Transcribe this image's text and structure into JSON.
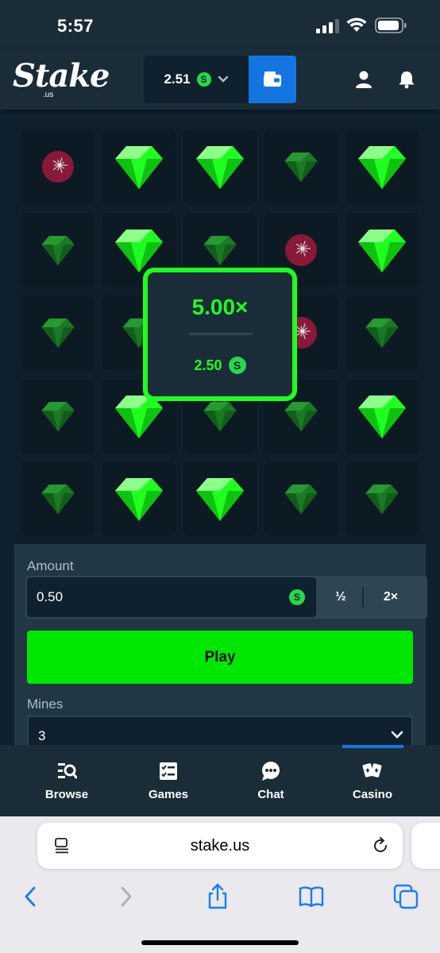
{
  "status_bar": {
    "time": "5:57"
  },
  "header": {
    "logo_text": "Stake",
    "logo_sub": ".us",
    "balance": "2.51",
    "currency_symbol": "S",
    "accent_color": "#1475e1"
  },
  "board": {
    "rows": 5,
    "cols": 5,
    "tiles": [
      [
        "mine-dim",
        "gem-bright",
        "gem-bright",
        "gem-dim",
        "gem-bright"
      ],
      [
        "gem-dim",
        "gem-bright",
        "gem-dim",
        "mine-dim",
        "gem-bright"
      ],
      [
        "gem-dim",
        "gem-dim",
        "gem-dim",
        "mine-dim",
        "gem-dim"
      ],
      [
        "gem-dim",
        "gem-bright",
        "gem-dim",
        "gem-dim",
        "gem-bright"
      ],
      [
        "gem-dim",
        "gem-bright",
        "gem-bright",
        "gem-dim",
        "gem-dim"
      ]
    ],
    "colors": {
      "gem_bright": "#1fff20",
      "gem_dim": "#1a7a24",
      "mine": "#8a1838"
    }
  },
  "win_popup": {
    "multiplier": "5.00×",
    "amount": "2.50",
    "currency_symbol": "S",
    "border_color": "#1fff20"
  },
  "controls": {
    "amount_label": "Amount",
    "amount_value": "0.50",
    "currency_symbol": "S",
    "half_label": "½",
    "double_label": "2×",
    "play_label": "Play",
    "play_color": "#00e701",
    "mines_label": "Mines",
    "mines_value": "3"
  },
  "bottom_nav": {
    "items": [
      {
        "label": "Browse",
        "icon": "browse-icon"
      },
      {
        "label": "Games",
        "icon": "games-icon"
      },
      {
        "label": "Chat",
        "icon": "chat-icon"
      },
      {
        "label": "Casino",
        "icon": "casino-icon"
      }
    ],
    "active": "Casino"
  },
  "safari": {
    "url": "stake.us"
  }
}
